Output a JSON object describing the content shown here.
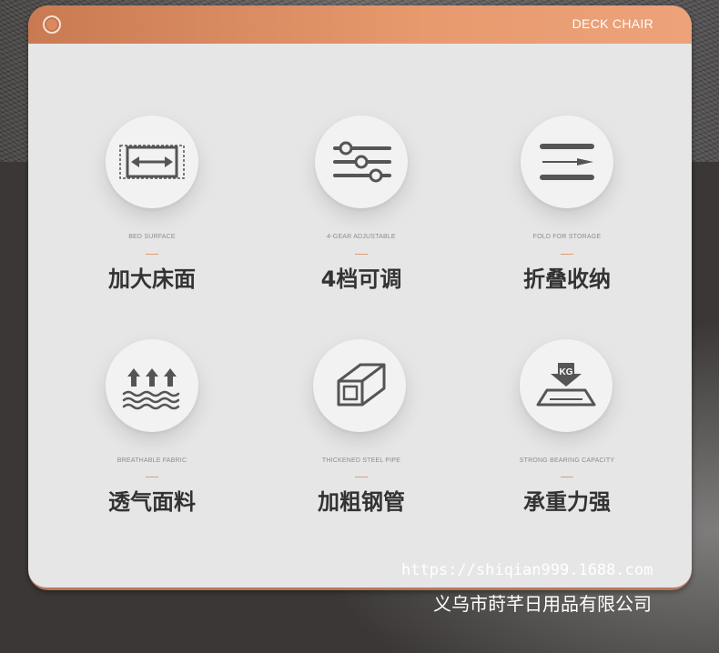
{
  "header": {
    "title": "DECK CHAIR"
  },
  "features": [
    {
      "en": "BED SURFACE",
      "cn": "加大床面",
      "icon": "expand-bed-icon"
    },
    {
      "en": "4-GEAR ADJUSTABLE",
      "cn": "4档可调",
      "icon": "sliders-icon"
    },
    {
      "en": "FOLD FOR STORAGE",
      "cn": "折叠收纳",
      "icon": "fold-icon"
    },
    {
      "en": "BREATHABLE FABRIC",
      "cn": "透气面料",
      "icon": "breathable-icon"
    },
    {
      "en": "THICKENED STEEL PIPE",
      "cn": "加粗钢管",
      "icon": "steel-pipe-icon"
    },
    {
      "en": "STRONG BEARING CAPACITY",
      "cn": "承重力强",
      "icon": "weight-bearing-icon"
    }
  ],
  "weight_icon_text": "KG",
  "footer": {
    "url": "https://shiqian999.1688.com",
    "company": "义乌市莳芊日用品有限公司"
  },
  "colors": {
    "accent": "#e29a78",
    "header_start": "#c97a52",
    "header_end": "#eda27a",
    "card": "#e6e6e6"
  }
}
